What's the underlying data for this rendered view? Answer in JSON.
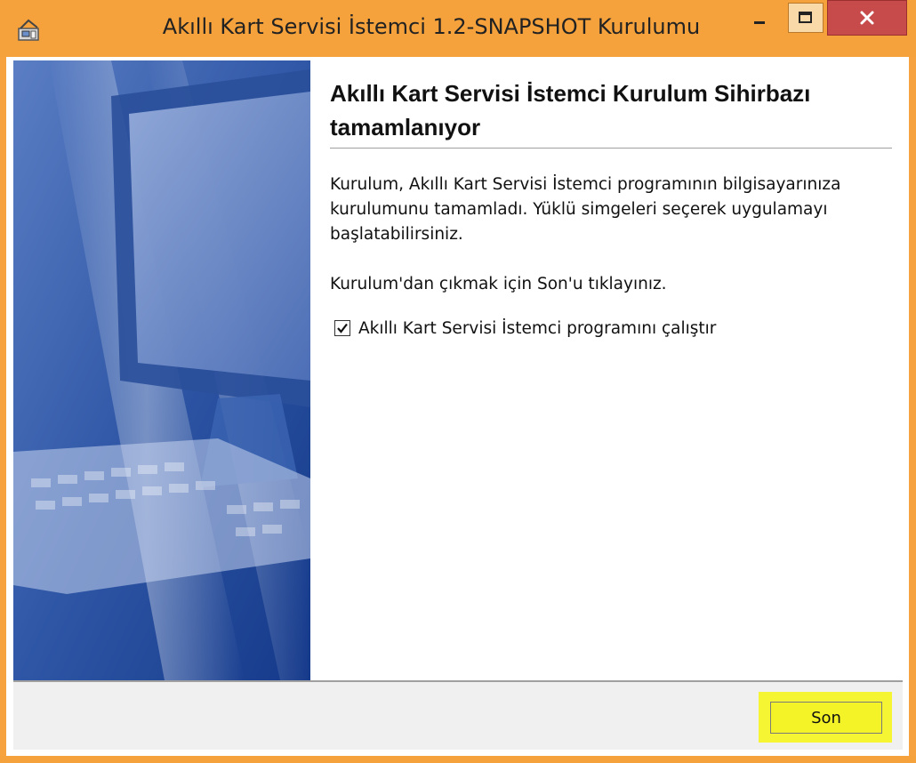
{
  "window": {
    "title": "Akıllı Kart Servisi İstemci 1.2-SNAPSHOT Kurulumu",
    "accent_color": "#f5a23c",
    "close_color": "#c74b4b"
  },
  "titlebar_buttons": {
    "minimize_icon": "minimize-icon",
    "maximize_icon": "maximize-icon",
    "close_icon": "close-icon",
    "close_glyph": "✕"
  },
  "content": {
    "heading": "Akıllı Kart Servisi İstemci Kurulum Sihirbazı tamamlanıyor",
    "body": "Kurulum, Akıllı Kart Servisi İstemci programının bilgisayarınıza kurulumunu tamamladı. Yüklü simgeleri seçerek uygulamayı başlatabilirsiniz.",
    "exit_instruction": "Kurulum'dan çıkmak için Son'u tıklayınız.",
    "run_checkbox": {
      "label": "Akıllı Kart Servisi İstemci programını çalıştır",
      "checked": true
    }
  },
  "footer": {
    "finish_label": "Son",
    "highlight_color": "#f6f533"
  },
  "sidebar": {
    "image": "installer-wizard-computer-image"
  }
}
